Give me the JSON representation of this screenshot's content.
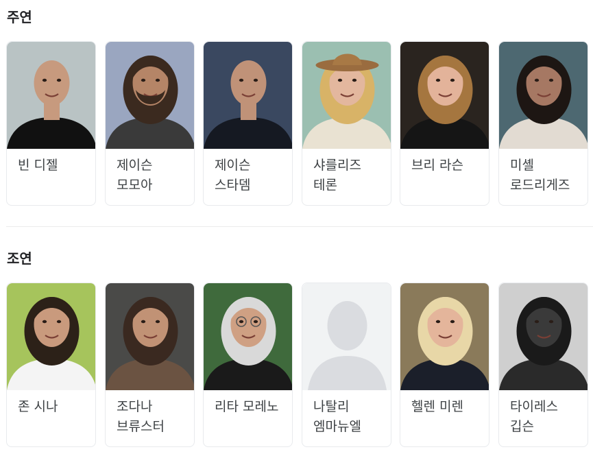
{
  "sections": [
    {
      "title": "주연",
      "cards": [
        {
          "name": "빈 디젤",
          "photo": "bald-man-black-shirt",
          "bg": "#b9c3c4",
          "skin": "#c79a7e",
          "hair": "none",
          "cloth": "#111111"
        },
        {
          "name": "제이슨 모모아",
          "photo": "long-haired-bearded-man",
          "bg": "#9aa6c0",
          "skin": "#b58567",
          "hair": "#3b2a1f",
          "cloth": "#3a3a3a"
        },
        {
          "name": "제이슨 스타뎀",
          "photo": "man-in-suit",
          "bg": "#3a4860",
          "skin": "#c09278",
          "hair": "none",
          "cloth": "#151922"
        },
        {
          "name": "샤를리즈 테론",
          "photo": "woman-with-hat",
          "bg": "#9bbfb1",
          "skin": "#e3b79e",
          "hair": "#d8b367",
          "cloth": "#e9e2d2"
        },
        {
          "name": "브리 라슨",
          "photo": "smiling-woman",
          "bg": "#2a241f",
          "skin": "#e3b39a",
          "hair": "#a5763f",
          "cloth": "#151515"
        },
        {
          "name": "미셸 로드리게즈",
          "photo": "woman-dark-hair",
          "bg": "#4d6871",
          "skin": "#a67863",
          "hair": "#1d1613",
          "cloth": "#e2dbd2"
        }
      ]
    },
    {
      "title": "조연",
      "cards": [
        {
          "name": "존 시나",
          "photo": "man-white-tshirt",
          "bg": "#a6c45c",
          "skin": "#c99a7d",
          "hair": "#2c2118",
          "cloth": "#f4f4f4"
        },
        {
          "name": "조다나 브류스터",
          "photo": "woman-long-brown-hair",
          "bg": "#4a4a48",
          "skin": "#c19275",
          "hair": "#3a2920",
          "cloth": "#6b5342"
        },
        {
          "name": "리타 모레노",
          "photo": "woman-grey-hair-glasses",
          "bg": "#3f6a3c",
          "skin": "#cfa083",
          "hair": "#d9d9d9",
          "cloth": "#1a1a1a"
        },
        {
          "name": "나탈리 엠마뉴엘",
          "photo": "placeholder-silhouette",
          "bg": "#f1f3f4",
          "skin": "#dadce0",
          "hair": "#dadce0",
          "cloth": "#dadce0"
        },
        {
          "name": "헬렌 미렌",
          "photo": "woman-blonde-earrings",
          "bg": "#8a7a5a",
          "skin": "#e4b59b",
          "hair": "#e8d7a7",
          "cloth": "#1b1f2a"
        },
        {
          "name": "타이레스 깁슨",
          "photo": "smiling-man-bw",
          "bg": "#cfcfcf",
          "skin": "#3a3a3a",
          "hair": "#1a1a1a",
          "cloth": "#2a2a2a"
        }
      ]
    }
  ]
}
